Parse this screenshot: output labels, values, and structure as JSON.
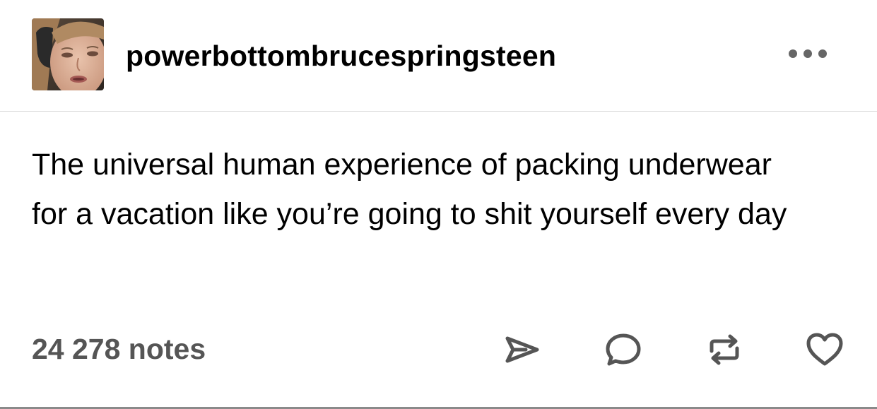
{
  "post": {
    "author": {
      "username": "powerbottombrucespringsteen",
      "avatar_icon": "profile-photo"
    },
    "more_icon": "ellipsis-icon",
    "body_text": "The universal human experience of packing underwear for a vacation like you’re going to shit yourself every day",
    "notes_label": "24 278 notes",
    "actions": {
      "share_icon": "share-icon",
      "reply_icon": "reply-icon",
      "reblog_icon": "reblog-icon",
      "like_icon": "heart-icon"
    },
    "colors": {
      "text": "#000000",
      "muted": "#555555",
      "divider": "#d9d9d9"
    }
  }
}
